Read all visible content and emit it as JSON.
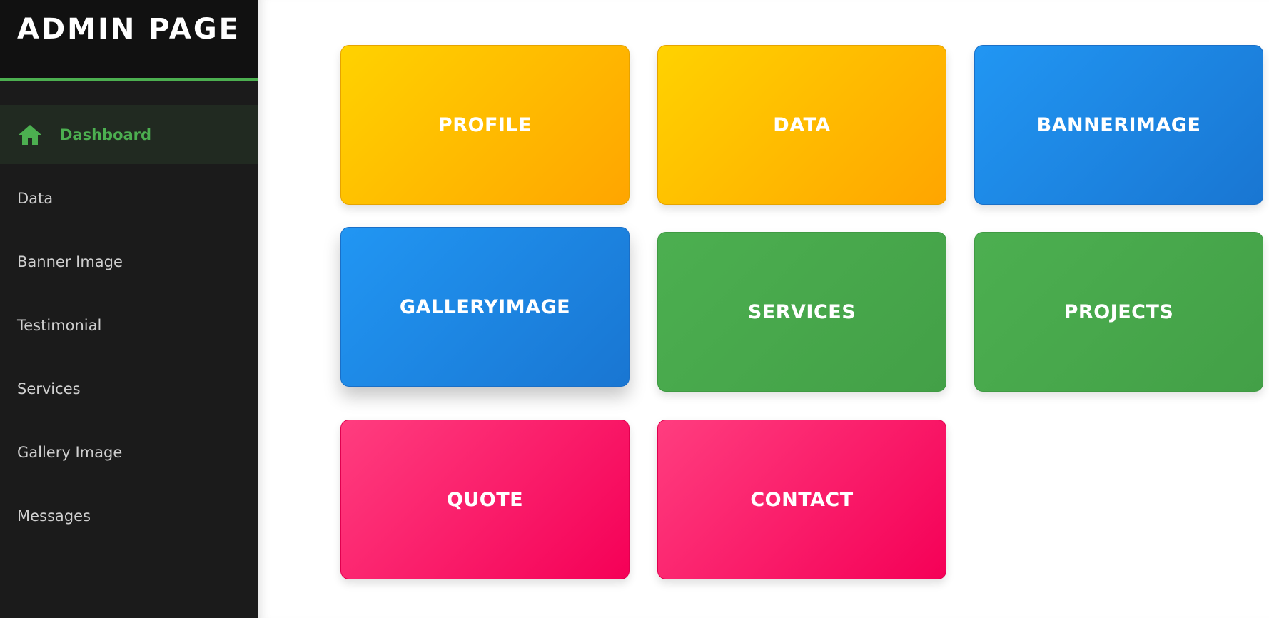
{
  "brand": {
    "title": "ADMIN PAGE",
    "accent_color": "#4caf50"
  },
  "sidebar": {
    "items": [
      {
        "label": "Dashboard",
        "icon": "home-icon",
        "active": true
      },
      {
        "label": "Data"
      },
      {
        "label": "Banner Image"
      },
      {
        "label": "Testimonial"
      },
      {
        "label": "Services"
      },
      {
        "label": "Gallery Image"
      },
      {
        "label": "Messages"
      }
    ]
  },
  "cards": [
    {
      "label": "PROFILE",
      "color": "yellow"
    },
    {
      "label": "DATA",
      "color": "yellow"
    },
    {
      "label": "BANNERIMAGE",
      "color": "blue"
    },
    {
      "label": "GALLERYIMAGE",
      "color": "blue"
    },
    {
      "label": "SERVICES",
      "color": "green"
    },
    {
      "label": "PROJECTS",
      "color": "green"
    },
    {
      "label": "QUOTE",
      "color": "pink"
    },
    {
      "label": "CONTACT",
      "color": "pink"
    }
  ],
  "colors": {
    "yellow": "#ffc107",
    "blue": "#2196f3",
    "green": "#4caf50",
    "pink": "#f50057"
  }
}
